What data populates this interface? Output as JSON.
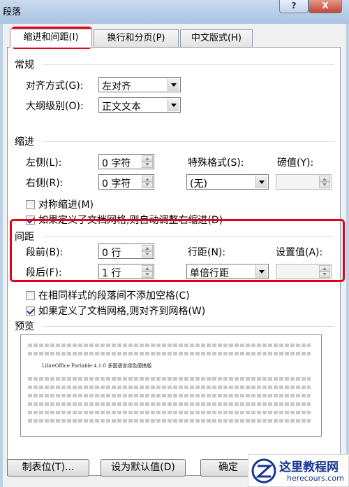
{
  "window": {
    "title": "段落",
    "help_label": "?",
    "close_label": "X"
  },
  "tabs": [
    {
      "label": "缩进和间距(I)",
      "active": true
    },
    {
      "label": "换行和分页(P)",
      "active": false
    },
    {
      "label": "中文版式(H)",
      "active": false
    }
  ],
  "general": {
    "title": "常规",
    "alignment_label": "对齐方式(G):",
    "alignment_value": "左对齐",
    "outline_label": "大纲级别(O):",
    "outline_value": "正文文本"
  },
  "indent": {
    "title": "缩进",
    "left_label": "左侧(L):",
    "left_value": "0 字符",
    "right_label": "右侧(R):",
    "right_value": "0 字符",
    "special_label": "特殊格式(S):",
    "special_value": "(无)",
    "by_label": "磅值(Y):",
    "by_value": "",
    "mirror_label": "对称缩进(M)",
    "mirror_checked": false,
    "auto_adjust_label": "如果定义了文档网格,则自动调整右缩进(D)",
    "auto_adjust_checked": true
  },
  "spacing": {
    "title": "间距",
    "before_label": "段前(B):",
    "before_value": "0 行",
    "after_label": "段后(F):",
    "after_value": "1 行",
    "line_label": "行距(N):",
    "line_value": "单倍行距",
    "at_label": "设置值(A):",
    "at_value": "",
    "no_space_label": "在相同样式的段落间不添加空格(C)",
    "no_space_checked": false,
    "snap_grid_label": "如果定义了文档网格,则对齐到网格(W)",
    "snap_grid_checked": true
  },
  "preview": {
    "title": "预览",
    "sample_text": "LibreOffice Portable 4.1.0 多国语言绿色便携版"
  },
  "buttons": {
    "tabs_label": "制表位(T)...",
    "default_label": "设为默认值(D)",
    "ok_label": "确定"
  },
  "watermark": {
    "title": "这里教程网",
    "url": "herecours.com"
  },
  "colors": {
    "highlight": "#e3001b",
    "watermark": "#16358f"
  }
}
